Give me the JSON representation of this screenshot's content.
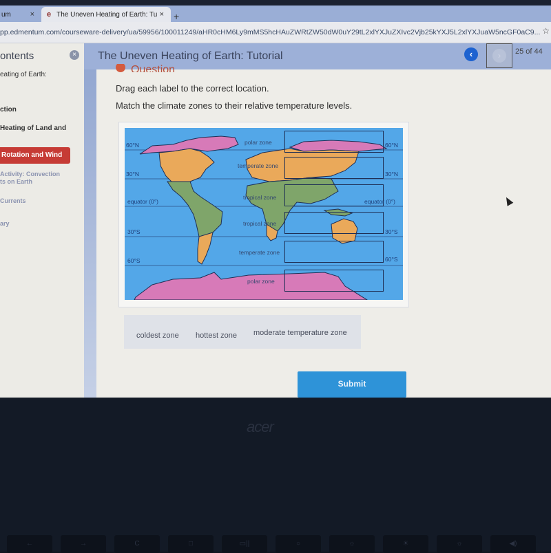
{
  "browser": {
    "tabs": [
      {
        "label": "um",
        "active": false
      },
      {
        "label": "The Uneven Heating of Earth: Tu",
        "active": true,
        "icon": "edmentum-e-icon"
      }
    ],
    "close_glyph": "×",
    "new_tab_glyph": "+",
    "url": "pp.edmentum.com/courseware-delivery/ua/59956/100011249/aHR0cHM6Ly9mMS5hcHAuZWRtZW50dW0uY29tL2xlYXJuZXIvc2Vjb25kYXJ5L2xlYXJuaW5ncGF0aC9...",
    "star_glyph": "☆"
  },
  "sidebar": {
    "title": "ontents",
    "close_glyph": "×",
    "items": [
      {
        "label": "eating of Earth:",
        "style": "normal"
      },
      {
        "label": "ction",
        "style": "bold"
      },
      {
        "label": "Heating of Land and",
        "style": "bold"
      },
      {
        "label": "Rotation and Wind",
        "style": "active"
      },
      {
        "label": "Activity: Convection",
        "style": "muted"
      },
      {
        "label": "ts on Earth",
        "style": "muted"
      },
      {
        "label": "Currents",
        "style": "muted"
      },
      {
        "label": "ary",
        "style": "muted"
      }
    ]
  },
  "header": {
    "title": "The Uneven Heating of Earth: Tutorial",
    "prev_glyph": "‹",
    "next_glyph": "›",
    "page_current": 25,
    "page_total": 44,
    "page_label": "25  of  44"
  },
  "question": {
    "heading": "Question",
    "instruction_1": "Drag each label to the correct location.",
    "instruction_2": "Match the climate zones to their relative temperature levels."
  },
  "map": {
    "colors": {
      "ocean": "#53a7e8",
      "polar": "#d77ab8",
      "temperate": "#eaa95a",
      "tropical": "#7fa56a",
      "outline": "#1f2f55"
    },
    "latitude_labels_left": [
      "60°N",
      "30°N",
      "equator (0°)",
      "30°S",
      "60°S"
    ],
    "latitude_labels_right": [
      "60°N",
      "30°N",
      "equator (0°)",
      "30°S",
      "60°S"
    ],
    "zone_labels": [
      "polar zone",
      "temperate zone",
      "tropical zone",
      "tropical zone",
      "temperate zone",
      "polar zone"
    ],
    "drop_targets": 6
  },
  "answer_labels": [
    "coldest zone",
    "hottest zone",
    "moderate temperature zone"
  ],
  "submit_label": "Submit",
  "laptop": {
    "brand": "acer",
    "keys": [
      "←",
      "→",
      "C",
      "□",
      "▭||",
      "○",
      "☼",
      "☀",
      "☼",
      "◀)"
    ]
  }
}
